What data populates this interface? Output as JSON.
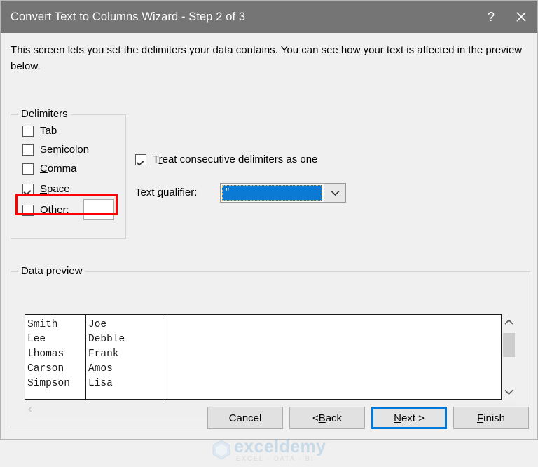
{
  "window": {
    "title": "Convert Text to Columns Wizard - Step 2 of 3",
    "help_label": "?",
    "close_label": "✕",
    "titlebar_color": "#757575",
    "body_color": "#f0f0f0"
  },
  "intro": {
    "text": "This screen lets you set the delimiters your data contains.  You can see how your text is affected in the preview below."
  },
  "delimiters": {
    "group_label": "Delimiters",
    "items": [
      {
        "label": "Tab",
        "checked": false,
        "accel": "T"
      },
      {
        "label": "Semicolon",
        "checked": false,
        "accel": "m"
      },
      {
        "label": "Comma",
        "checked": false,
        "accel": "C"
      },
      {
        "label": "Space",
        "checked": true,
        "accel": "S"
      },
      {
        "label": "Other:",
        "checked": false,
        "accel": "O"
      }
    ],
    "other_value": "",
    "highlight_color": "#ff0000",
    "highlighted_item": "Space"
  },
  "options": {
    "consecutive_label": "Treat consecutive delimiters as one",
    "consecutive_checked": true,
    "qualifier_label": "Text qualifier:",
    "qualifier_value": "\"",
    "qualifier_selected": true,
    "qualifier_highlight_color": "#0a7ad4",
    "qualifier_arrow": "⌄"
  },
  "preview": {
    "group_label": "Data preview",
    "columns": [
      {
        "rows": [
          "Smith",
          "Lee",
          "thomas",
          "Carson",
          "Simpson"
        ]
      },
      {
        "rows": [
          "Joe",
          "Debble",
          "Frank",
          "Amos",
          "Lisa"
        ]
      }
    ],
    "vscroll_up": "∧",
    "vscroll_down": "∨",
    "hscroll_left": "‹",
    "hscroll_right": "›"
  },
  "footer": {
    "buttons": [
      {
        "label": "Cancel",
        "focused": false
      },
      {
        "label": "< Back",
        "focused": false
      },
      {
        "label": "Next >",
        "focused": true
      },
      {
        "label": "Finish",
        "focused": false
      }
    ],
    "focus_color": "#0078d7"
  },
  "watermark": {
    "name": "exceldemy",
    "tagline": "EXCEL · DATA · BI"
  }
}
